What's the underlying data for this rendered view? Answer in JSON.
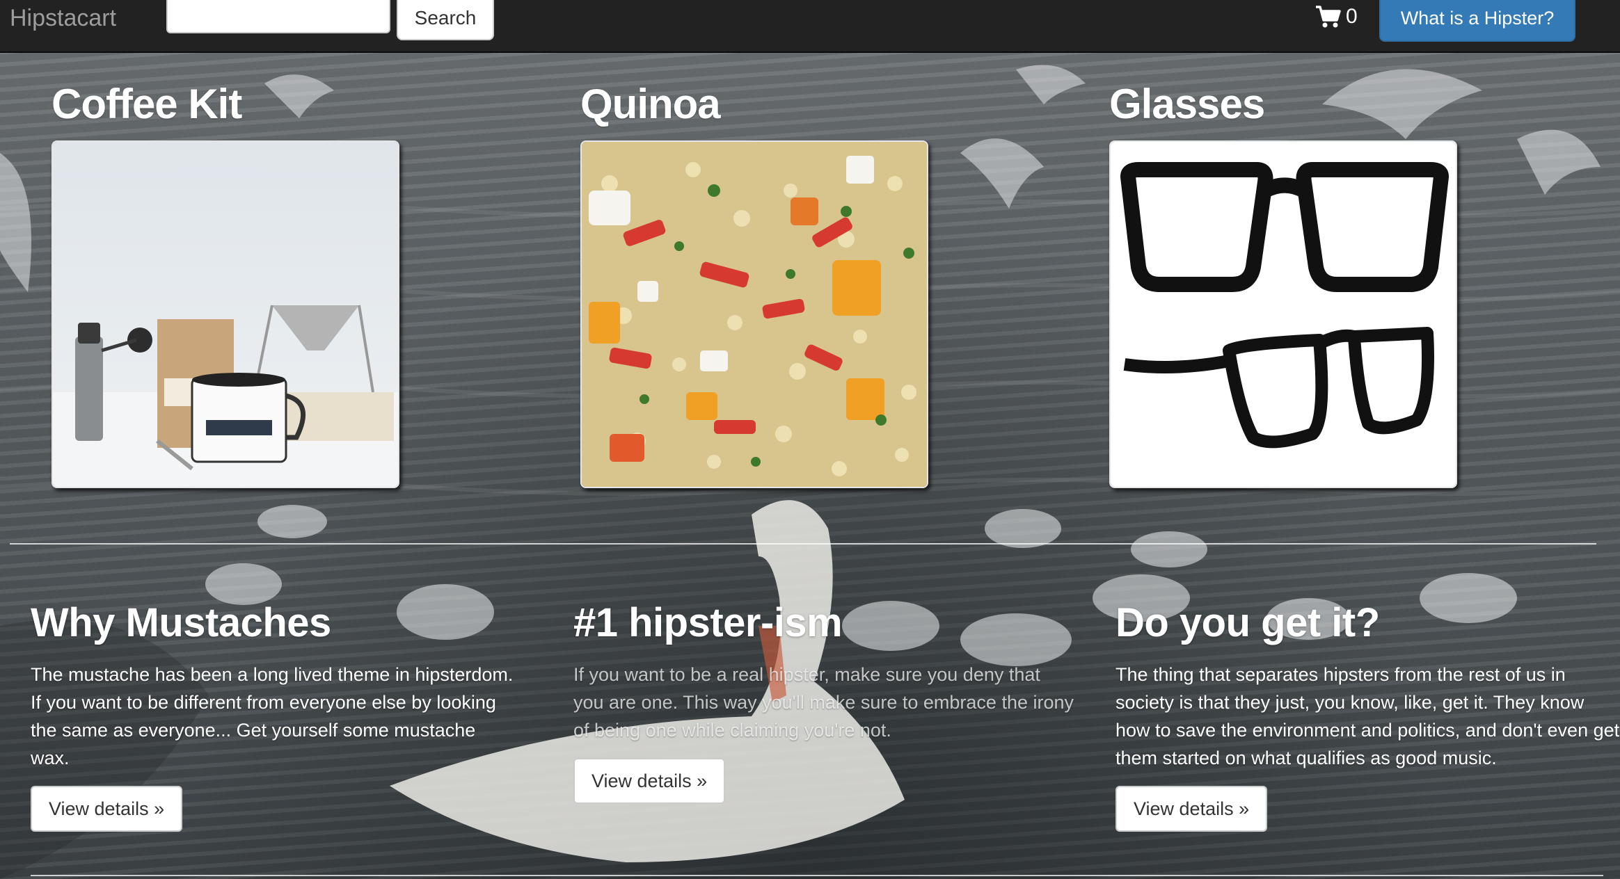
{
  "navbar": {
    "brand": "Hipstacart",
    "search_value": "",
    "search_button": "Search",
    "cart_count": "0",
    "cart_icon": "shopping-cart-icon",
    "hipster_button": "What is a Hipster?"
  },
  "products": [
    {
      "title": "Coffee Kit"
    },
    {
      "title": "Quinoa"
    },
    {
      "title": "Glasses"
    }
  ],
  "features": [
    {
      "heading": "Why Mustaches",
      "text": "The mustache has been a long lived theme in hipsterdom. If you want to be different from everyone else by looking the same as everyone... Get yourself some mustache wax.",
      "button": "View details »"
    },
    {
      "heading": "#1 hipster-ism",
      "text": "If you want to be a real hipster, make sure you deny that you are one. This way you'll make sure to embrace the irony of being one while claiming you're not.",
      "button": "View details »"
    },
    {
      "heading": "Do you get it?",
      "text": "The thing that separates hipsters from the rest of us in society is that they just, you know, like, get it. They know how to save the environment and politics, and don't even get them started on what qualifies as good music.",
      "button": "View details »"
    }
  ],
  "colors": {
    "navbar_bg": "#222222",
    "brand_text": "#9d9d9d",
    "primary_button": "#337ab7"
  }
}
